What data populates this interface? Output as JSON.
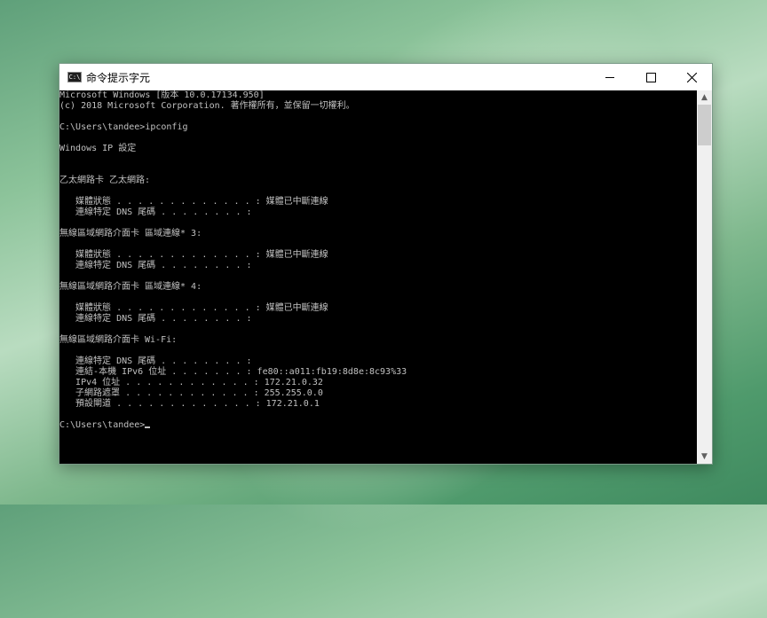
{
  "window": {
    "title": "命令提示字元",
    "icon_label": "C:\\",
    "controls": {
      "minimize": "minimize",
      "maximize": "maximize",
      "close": "close"
    }
  },
  "console": {
    "lines": [
      "Microsoft Windows [版本 10.0.17134.950]",
      "(c) 2018 Microsoft Corporation. 著作權所有，並保留一切權利。",
      "",
      "C:\\Users\\tandee>ipconfig",
      "",
      "Windows IP 設定",
      "",
      "",
      "乙太網路卡 乙太網路:",
      "",
      "   媒體狀態 . . . . . . . . . . . . . : 媒體已中斷連線",
      "   連線特定 DNS 尾碼 . . . . . . . . :",
      "",
      "無線區域網路介面卡 區域連線* 3:",
      "",
      "   媒體狀態 . . . . . . . . . . . . . : 媒體已中斷連線",
      "   連線特定 DNS 尾碼 . . . . . . . . :",
      "",
      "無線區域網路介面卡 區域連線* 4:",
      "",
      "   媒體狀態 . . . . . . . . . . . . . : 媒體已中斷連線",
      "   連線特定 DNS 尾碼 . . . . . . . . :",
      "",
      "無線區域網路介面卡 Wi-Fi:",
      "",
      "   連線特定 DNS 尾碼 . . . . . . . . :",
      "   連結-本機 IPv6 位址 . . . . . . . : fe80::a011:fb19:8d8e:8c93%33",
      "   IPv4 位址 . . . . . . . . . . . . : 172.21.0.32",
      "   子網路遮罩 . . . . . . . . . . . . : 255.255.0.0",
      "   預設閘道 . . . . . . . . . . . . . : 172.21.0.1",
      ""
    ],
    "prompt": "C:\\Users\\tandee>"
  },
  "scrollbar": {
    "up": "▲",
    "down": "▼",
    "position": 0
  }
}
